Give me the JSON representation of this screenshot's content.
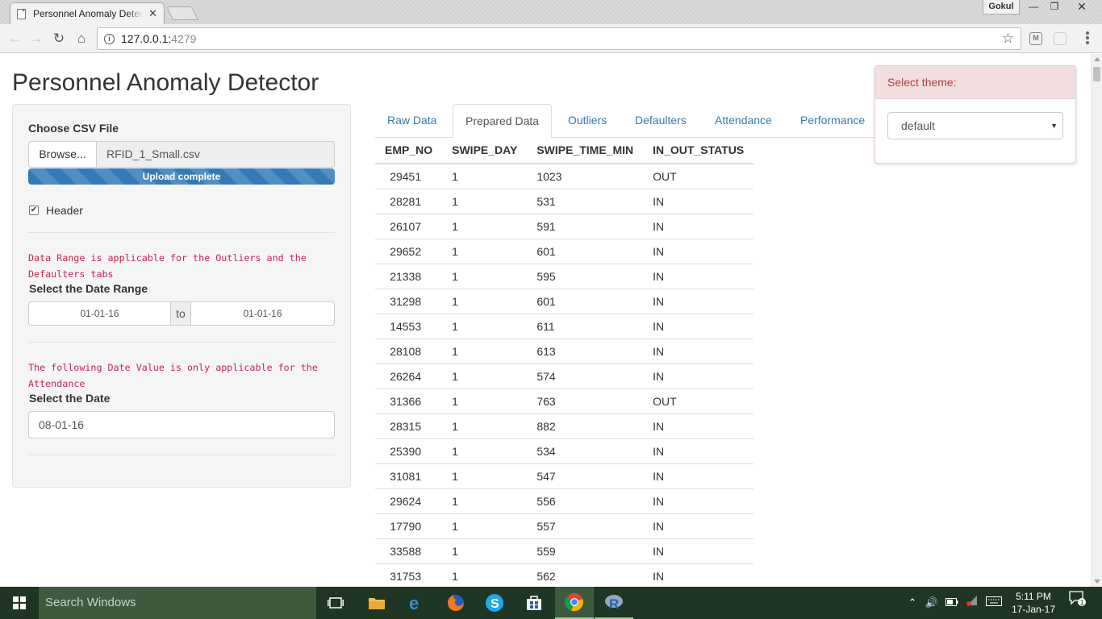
{
  "browser": {
    "tab_title": "Personnel Anomaly Detector",
    "tab_close": "✕",
    "profile_name": "Gokul",
    "url_host": "127.0.0.1:",
    "url_port": "4279"
  },
  "app": {
    "title": "Personnel Anomaly Detector"
  },
  "sidebar": {
    "file_label": "Choose CSV File",
    "browse_label": "Browse...",
    "file_name": "RFID_1_Small.csv",
    "upload_status": "Upload complete",
    "upload_progress_percent": 100,
    "header_label": "Header",
    "header_checked": true,
    "range_note": "Data Range is applicable for the Outliers and the Defaulters tabs",
    "range_label": "Select the Date Range",
    "range_start": "01-01-16",
    "range_sep": "to",
    "range_end": "01-01-16",
    "date_note": "The following Date Value is only applicable for the Attendance",
    "date_label": "Select the Date",
    "date_value": "08-01-16"
  },
  "tabs": [
    {
      "label": "Raw Data",
      "active": false
    },
    {
      "label": "Prepared Data",
      "active": true
    },
    {
      "label": "Outliers",
      "active": false
    },
    {
      "label": "Defaulters",
      "active": false
    },
    {
      "label": "Attendance",
      "active": false
    },
    {
      "label": "Performance",
      "active": false
    }
  ],
  "table": {
    "columns": [
      "EMP_NO",
      "SWIPE_DAY",
      "SWIPE_TIME_MIN",
      "IN_OUT_STATUS"
    ],
    "rows": [
      [
        "29451",
        "1",
        "1023",
        "OUT"
      ],
      [
        "28281",
        "1",
        "531",
        "IN"
      ],
      [
        "26107",
        "1",
        "591",
        "IN"
      ],
      [
        "29652",
        "1",
        "601",
        "IN"
      ],
      [
        "21338",
        "1",
        "595",
        "IN"
      ],
      [
        "31298",
        "1",
        "601",
        "IN"
      ],
      [
        "14553",
        "1",
        "611",
        "IN"
      ],
      [
        "28108",
        "1",
        "613",
        "IN"
      ],
      [
        "26264",
        "1",
        "574",
        "IN"
      ],
      [
        "31366",
        "1",
        "763",
        "OUT"
      ],
      [
        "28315",
        "1",
        "882",
        "IN"
      ],
      [
        "25390",
        "1",
        "534",
        "IN"
      ],
      [
        "31081",
        "1",
        "547",
        "IN"
      ],
      [
        "29624",
        "1",
        "556",
        "IN"
      ],
      [
        "17790",
        "1",
        "557",
        "IN"
      ],
      [
        "33588",
        "1",
        "559",
        "IN"
      ],
      [
        "31753",
        "1",
        "562",
        "IN"
      ]
    ]
  },
  "theme_selector": {
    "label": "Select theme:",
    "value": "default"
  },
  "taskbar": {
    "search_placeholder": "Search Windows",
    "time": "5:11 PM",
    "date": "17-Jan-17",
    "notification_count": "1"
  },
  "colors": {
    "link": "#337ab7",
    "progress": "#337ab7",
    "code_text": "#c7254e",
    "theme_head_bg": "#f2dede",
    "theme_head_text": "#a94442",
    "taskbar": "#1e3623"
  }
}
